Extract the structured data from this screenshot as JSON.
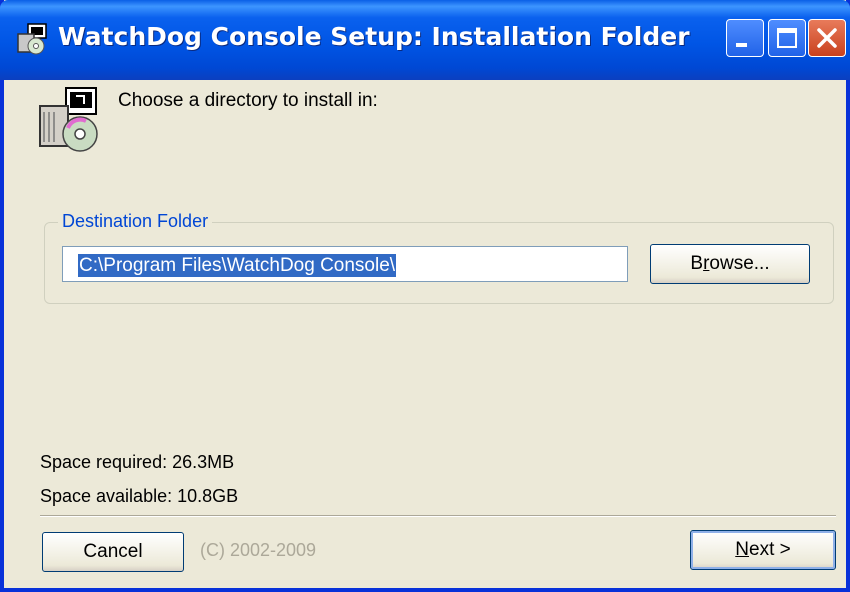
{
  "window": {
    "title": "WatchDog Console Setup: Installation Folder",
    "icon": "installer-icon",
    "controls": {
      "minimize": "minimize-icon",
      "maximize": "maximize-icon",
      "close": "close-icon"
    },
    "colors": {
      "titlebar": "#0054e3",
      "face": "#ece9d8",
      "legend": "#0046d5",
      "selection": "#316ac5",
      "close": "#c9411e"
    }
  },
  "header": {
    "icon": "setup-disk-icon",
    "instruction": "Choose a directory to install in:"
  },
  "destination": {
    "legend": "Destination Folder",
    "path": "C:\\Program Files\\WatchDog Console\\",
    "browse_pre": "B",
    "browse_ul": "r",
    "browse_post": "owse..."
  },
  "space": {
    "required": "Space required: 26.3MB",
    "available": "Space available: 10.8GB"
  },
  "footer": {
    "cancel_label": "Cancel",
    "copyright": "(C) 2002-2009",
    "next_ul": "N",
    "next_post": "ext >"
  }
}
